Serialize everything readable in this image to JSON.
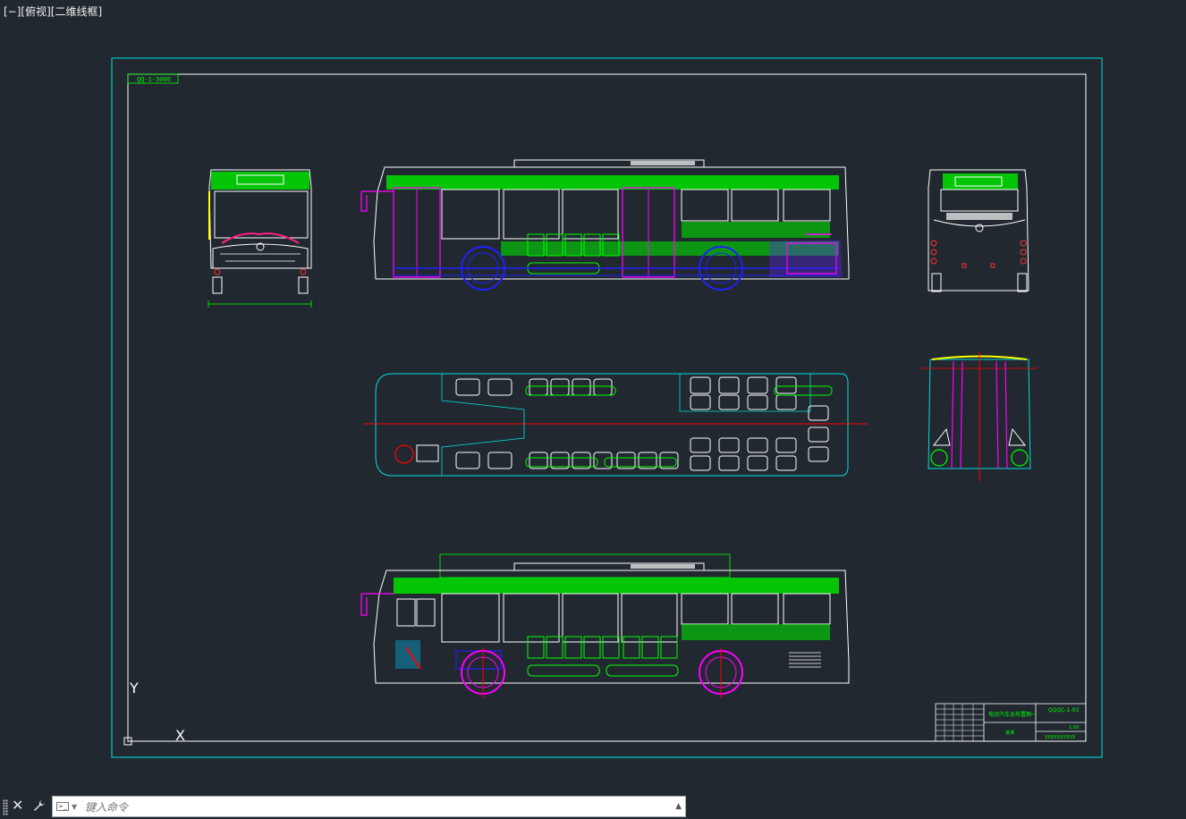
{
  "viewport": {
    "label": "[−][俯视][二维线框]"
  },
  "drawing": {
    "frame_ref": "QQ-1-3000",
    "title_block": {
      "drawing_name": "电动汽车总布置图一",
      "drawing_no": "QQQC-1-03",
      "scale": "1:50",
      "company": "XXXXXXXXXX",
      "approval": "批准"
    },
    "axis": {
      "y": "Y",
      "x": "X"
    }
  },
  "command_line": {
    "placeholder": "键入命令"
  },
  "colors": {
    "background": "#212830",
    "border": "#00c8c8",
    "green": "#00ff00",
    "magenta": "#ff00ff",
    "blue": "#2020ff",
    "red": "#ff0000",
    "white": "#ffffff"
  }
}
